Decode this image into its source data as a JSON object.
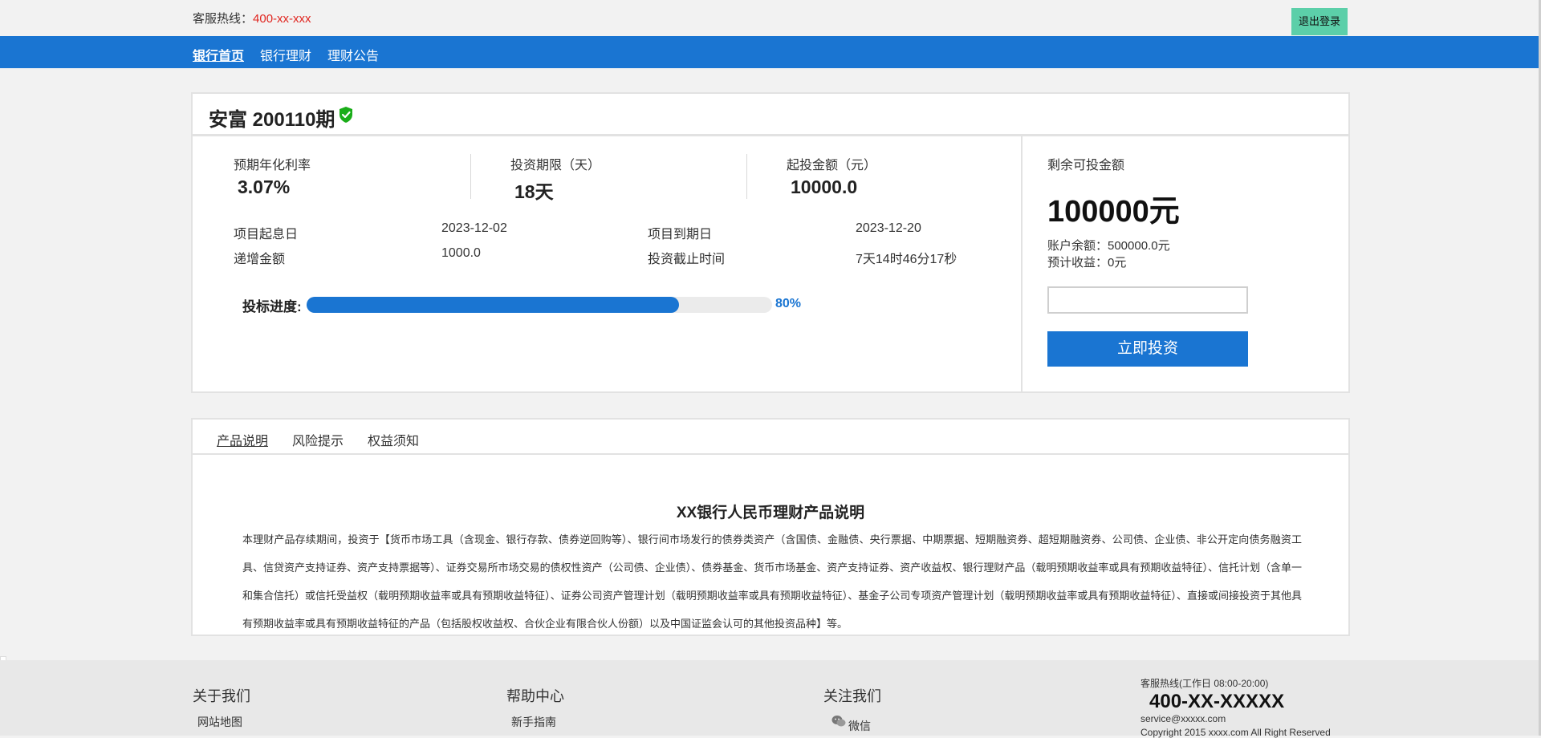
{
  "header": {
    "hotline_label": "客服热线：",
    "hotline_number": "400-xx-xxx",
    "logout_label": "退出登录"
  },
  "nav": {
    "items": [
      {
        "label": "银行首页",
        "active": true
      },
      {
        "label": "银行理财",
        "active": false
      },
      {
        "label": "理财公告",
        "active": false
      }
    ]
  },
  "product": {
    "title": "安富 200110期",
    "badge_icon": "verified-shield-icon",
    "stats": [
      {
        "label": "预期年化利率",
        "value": "3.07%"
      },
      {
        "label": "投资期限（天）",
        "value": "18天"
      },
      {
        "label": "起投金额（元）",
        "value": "10000.0"
      }
    ],
    "start_date_label": "项目起息日",
    "start_date": "2023-12-02",
    "end_date_label": "项目到期日",
    "end_date": "2023-12-20",
    "increment_label": "递增金额",
    "increment": "1000.0",
    "deadline_label": "投资截止时间",
    "deadline": "7天14时46分17秒",
    "progress_label": "投标进度:",
    "progress_value": 0.8,
    "progress_text": "80%"
  },
  "invest": {
    "remaining_label": "剩余可投金额",
    "remaining_amount": "100000元",
    "balance_text": "账户余额：500000.0元",
    "expected_text": "预计收益：0元",
    "input_value": "",
    "button_label": "立即投资"
  },
  "tabs": [
    {
      "label": "产品说明",
      "active": true
    },
    {
      "label": "风险提示",
      "active": false
    },
    {
      "label": "权益须知",
      "active": false
    }
  ],
  "description": {
    "title": "XX银行人民币理财产品说明",
    "body": "本理财产品存续期间，投资于【货币市场工具（含现金、银行存款、债券逆回购等）、银行间市场发行的债券类资产（含国债、金融债、央行票据、中期票据、短期融资券、超短期融资券、公司债、企业债、非公开定向债务融资工具、信贷资产支持证券、资产支持票据等）、证券交易所市场交易的债权性资产（公司债、企业债）、债券基金、货币市场基金、资产支持证券、资产收益权、银行理财产品（载明预期收益率或具有预期收益特征）、信托计划（含单一和集合信托）或信托受益权（载明预期收益率或具有预期收益特征）、证券公司资产管理计划（载明预期收益率或具有预期收益特征）、基金子公司专项资产管理计划（载明预期收益率或具有预期收益特征）、直接或间接投资于其他具有预期收益率或具有预期收益特征的产品（包括股权收益权、合伙企业有限合伙人份额）以及中国证监会认可的其他投资品种】等。"
  },
  "footer": {
    "about_title": "关于我们",
    "about_link": "网站地图",
    "help_title": "帮助中心",
    "help_link": "新手指南",
    "follow_title": "关注我们",
    "follow_wechat": "微信",
    "wechat_icon": "wechat-icon",
    "contact_head": "客服热线(工作日 08:00-20:00)",
    "contact_phone": "400-XX-XXXXX",
    "contact_email": "service@xxxxx.com",
    "copyright": "Copyright 2015 xxxx.com All Right Reserved"
  },
  "colors": {
    "brand_blue": "#1a75d2",
    "logout_green": "#5ccfa9",
    "hotline_red": "#e0251f",
    "verified_green": "#1aad19"
  }
}
